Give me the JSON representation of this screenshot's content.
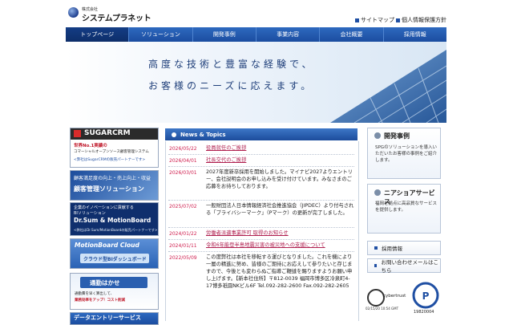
{
  "header": {
    "company_small": "株式会社",
    "company_name": "システムプラネット",
    "links": [
      "サイトマップ",
      "個人情報保護方針"
    ]
  },
  "nav": [
    "トップページ",
    "ソリューション",
    "開発事例",
    "事業内容",
    "会社概要",
    "採用情報"
  ],
  "hero": {
    "line1": "高度な技術と豊富な経験で、",
    "line2": "お客様のニーズに応えます。"
  },
  "banners": {
    "sugar_logo": "SUGARCRM",
    "sugar_line1": "世界No.1実績の",
    "sugar_line2": "コマーシャルオープンソース顧客管理システム",
    "sugar_line3": "<弊社はSugarCRMの販売パートナーです>",
    "crm_line1": "顧客満足度の向上・売上向上・収益",
    "crm_line2": "顧客管理ソリューション",
    "dr_line1": "企業のイノベーションに貢献する",
    "dr_line2": "BIソリューション",
    "dr_title": "Dr.Sum & MotionBoard",
    "dr_line3": "<弊社はDr.Sum/MotionBoardの販売パートナーです>",
    "mb_title": "MotionBoard Cloud",
    "mb_sub": "クラウド型BIダッシュボード",
    "tsukin_title": "通勤はかせ",
    "tsukin_line1": "通勤費を早く算出して、",
    "tsukin_line2": "業務効率をアップ！コスト削減",
    "data_entry": "データエントリーサービス"
  },
  "news": {
    "title": "News & Topics",
    "items": [
      {
        "date": "2026/05/22",
        "text": "役員就任のご挨拶",
        "link": true
      },
      {
        "date": "2026/04/01",
        "text": "社長交代のご挨拶",
        "link": true
      },
      {
        "date": "2026/03/01",
        "text": "2027年度新卒採用を開始しました。マイナビ2027よりエントリー、会社説明会のお申し込みを受け付けています。みなさまのご応募をお待ちしております。",
        "link": false
      },
      {
        "date": "2025/07/02",
        "text": "一般財団法人日本情報経済社会推進協会（JIPDEC）より付与される「プライバシーマーク」（Pマーク）の更新が完了しました。",
        "link": false
      },
      {
        "date": "2024/01/22",
        "text": "労働者派遣事業許可 取得のお知らせ",
        "link": true
      },
      {
        "date": "2024/01/11",
        "text": "令和6年能登半島地震災害の被災地への支援について",
        "link": true
      },
      {
        "date": "2022/05/09",
        "text": "この度弊社は本社を移転する運びとなりました。これを機により一層の精進に努め、皆様のご期待にお応えして参りたいと存じますので、今後とも変わらぬご指導ご鞭撻を賜りますようお願い申し上げます。【新本社住所】〒812-0039 福岡市博多区冷泉町4-17博多祇園NKビル6F Tel.092-282-2600 Fax.092-282-2605",
        "link": false
      }
    ]
  },
  "right": {
    "case_title": "開発事例",
    "case_desc": "SPGのソリューションを導入いただいたお客様の事例をご紹介します。",
    "nearshore_title": "ニアショアサービス",
    "nearshore_desc": "福岡を拠点に高品質なサービスを提供します。",
    "recruit": "採用情報",
    "contact": "お問い合わせメールはこちら",
    "cert_label": "cybertrust",
    "cert_date": "02/15/20 10:54 GMT",
    "pmark_num": "19820004"
  }
}
